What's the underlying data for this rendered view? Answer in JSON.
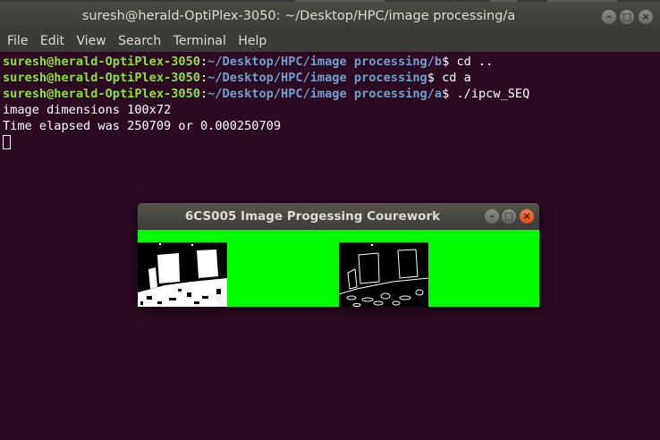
{
  "terminal": {
    "title": "suresh@herald-OptiPlex-3050: ~/Desktop/HPC/image processing/a",
    "menu": [
      "File",
      "Edit",
      "View",
      "Search",
      "Terminal",
      "Help"
    ],
    "lines": [
      {
        "user": "suresh@herald-OptiPlex-3050",
        "path": "~/Desktop/HPC/image processing/b",
        "cmd": "$ cd .."
      },
      {
        "user": "suresh@herald-OptiPlex-3050",
        "path": "~/Desktop/HPC/image processing",
        "cmd": "$ cd a"
      },
      {
        "user": "suresh@herald-OptiPlex-3050",
        "path": "~/Desktop/HPC/image processing/a",
        "cmd": "$ ./ipcw_SEQ"
      }
    ],
    "output": [
      "image dimensions 100x72",
      "Time elapsed was 250709 or 0.000250709"
    ]
  },
  "image_window": {
    "title": "6CS005 Image Progessing Courework",
    "background_color": "#00ff00"
  },
  "colors": {
    "terminal_bg": "#2c0a22",
    "user_color": "#8ae234",
    "path_color": "#729fcf"
  }
}
